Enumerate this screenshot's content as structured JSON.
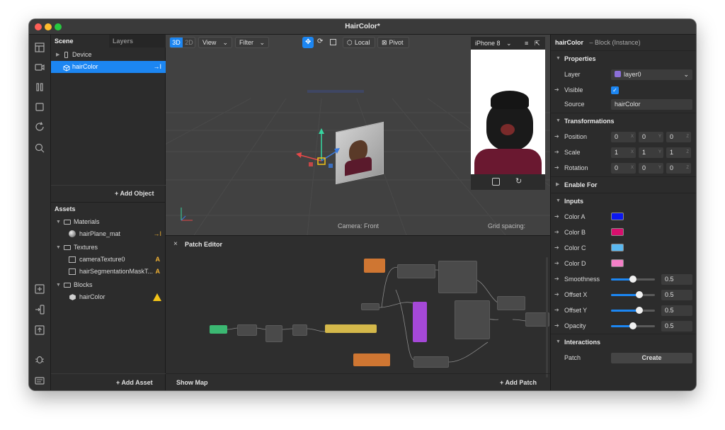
{
  "window": {
    "title": "HairColor*"
  },
  "scene": {
    "tabs": [
      "Scene",
      "Layers"
    ],
    "items": [
      {
        "label": "Device"
      },
      {
        "label": "hairColor",
        "badge": "→I"
      }
    ],
    "add_object": "Add Object"
  },
  "assets": {
    "header": "Assets",
    "groups": [
      {
        "label": "Materials",
        "children": [
          {
            "label": "hairPlane_mat",
            "badge": "→I"
          }
        ]
      },
      {
        "label": "Textures",
        "children": [
          {
            "label": "cameraTexture0",
            "badge": "A"
          },
          {
            "label": "hairSegmentationMaskT...",
            "badge": "A"
          }
        ]
      },
      {
        "label": "Blocks",
        "children": [
          {
            "label": "hairColor",
            "badge": "!"
          }
        ]
      }
    ],
    "add_asset": "Add Asset"
  },
  "viewport": {
    "toggle_3d": "3D",
    "toggle_2d": "2D",
    "view_label": "View",
    "filter_label": "Filter",
    "local_label": "Local",
    "pivot_label": "Pivot",
    "device": "iPhone 8",
    "camera_label": "Camera: Front",
    "grid_label": "Grid spacing:"
  },
  "patch_editor": {
    "title": "Patch Editor",
    "show_map": "Show Map",
    "add_patch": "Add Patch"
  },
  "inspector": {
    "header_name": "hairColor",
    "header_type": "– Block (Instance)",
    "properties": {
      "title": "Properties",
      "layer_label": "Layer",
      "layer_value": "layer0",
      "visible_label": "Visible",
      "source_label": "Source",
      "source_value": "hairColor"
    },
    "transformations": {
      "title": "Transformations",
      "position_label": "Position",
      "position": [
        "0",
        "0",
        "0"
      ],
      "scale_label": "Scale",
      "scale": [
        "1",
        "1",
        "1"
      ],
      "rotation_label": "Rotation",
      "rotation": [
        "0",
        "0",
        "0"
      ],
      "axes": [
        "X",
        "Y",
        "Z"
      ]
    },
    "enable_for": "Enable For",
    "inputs": {
      "title": "Inputs",
      "colors": [
        {
          "label": "Color A",
          "hex": "#0b18f0"
        },
        {
          "label": "Color B",
          "hex": "#d80f6e"
        },
        {
          "label": "Color C",
          "hex": "#5ab8f0"
        },
        {
          "label": "Color D",
          "hex": "#f47fc7"
        }
      ],
      "sliders": [
        {
          "label": "Smoothness",
          "value": "0.5",
          "fraction": 0.5
        },
        {
          "label": "Offset X",
          "value": "0.5",
          "fraction": 0.65
        },
        {
          "label": "Offset Y",
          "value": "0.5",
          "fraction": 0.65
        },
        {
          "label": "Opacity",
          "value": "0.5",
          "fraction": 0.5
        }
      ]
    },
    "interactions": {
      "title": "Interactions",
      "patch_label": "Patch",
      "create_label": "Create"
    }
  }
}
